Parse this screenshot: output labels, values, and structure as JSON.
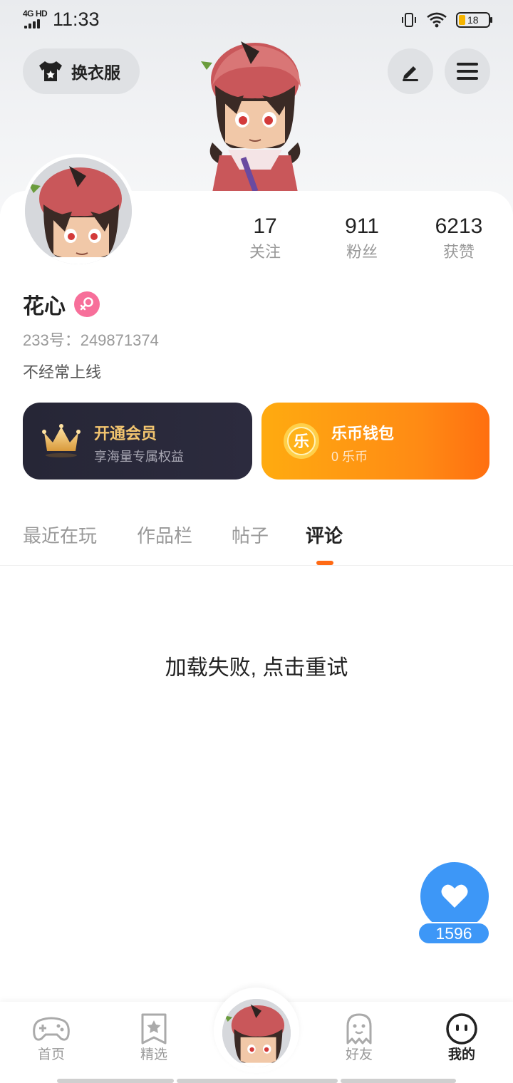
{
  "status_bar": {
    "network": "4G HD",
    "time": "11:33",
    "battery_level": "18",
    "icons": [
      "signal-icon",
      "vibrate-icon",
      "wifi-icon",
      "battery-icon"
    ]
  },
  "header": {
    "outfit_button_label": "换衣服",
    "icons": [
      "shirt-icon",
      "edit-icon",
      "menu-icon"
    ]
  },
  "profile": {
    "stats": [
      {
        "value": "17",
        "label": "关注"
      },
      {
        "value": "911",
        "label": "粉丝"
      },
      {
        "value": "6213",
        "label": "获赞"
      }
    ],
    "username": "花心",
    "gender": "female",
    "user_id": "233号：249871374",
    "status": "不经常上线"
  },
  "cards": {
    "vip": {
      "title": "开通会员",
      "subtitle": "享海量专属权益"
    },
    "wallet": {
      "title": "乐币钱包",
      "subtitle": "0 乐币",
      "coin_glyph": "乐"
    }
  },
  "tabs": [
    {
      "label": "最近在玩",
      "active": false
    },
    {
      "label": "作品栏",
      "active": false
    },
    {
      "label": "帖子",
      "active": false
    },
    {
      "label": "评论",
      "active": true
    }
  ],
  "content": {
    "error_message": "加载失败, 点击重试"
  },
  "like": {
    "count": "1596"
  },
  "bottom_nav": [
    {
      "label": "首页",
      "icon": "gamepad-icon",
      "active": false
    },
    {
      "label": "精选",
      "icon": "star-icon",
      "active": false
    },
    {
      "label": "",
      "icon": "character-avatar",
      "active": false
    },
    {
      "label": "好友",
      "icon": "ghost-icon",
      "active": false
    },
    {
      "label": "我的",
      "icon": "smiley-icon",
      "active": true
    }
  ],
  "colors": {
    "accent": "#ff6a14",
    "like_blue": "#3d97f7",
    "vip_gold": "#f3c56f",
    "gender_pink": "#f76f9a"
  }
}
